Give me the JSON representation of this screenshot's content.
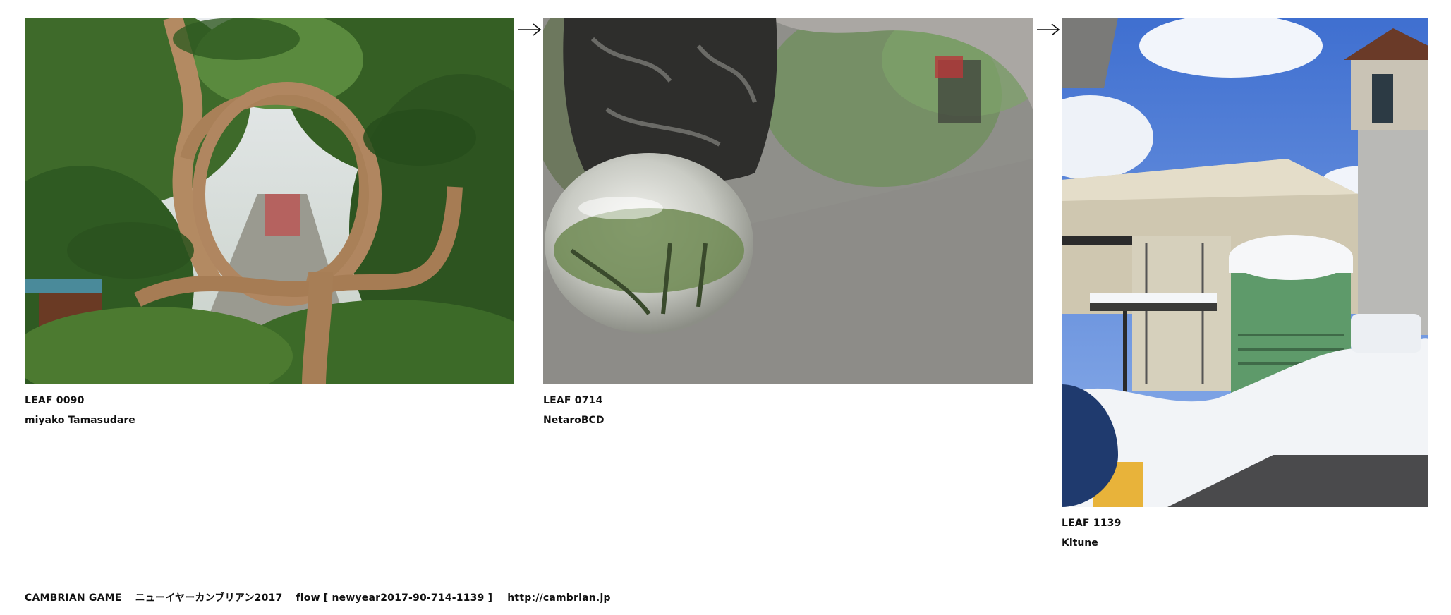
{
  "leaves": [
    {
      "code": "LEAF 0090",
      "author": "miyako Tamasudare",
      "photo_icon": "pine-tree-loops-photo"
    },
    {
      "code": "LEAF 0714",
      "author": "NetaroBCD",
      "photo_icon": "glass-sphere-reflection-photo"
    },
    {
      "code": "LEAF 1139",
      "author": "Kitune",
      "photo_icon": "snowy-building-tank-photo"
    }
  ],
  "arrows": [
    "arrow-right-icon",
    "arrow-right-icon"
  ],
  "footer": {
    "title": "CAMBRIAN GAME",
    "subtitle": "ニューイヤーカンブリアン2017",
    "flow": "flow [ newyear2017-90-714-1139 ]",
    "url": "http://cambrian.jp"
  }
}
